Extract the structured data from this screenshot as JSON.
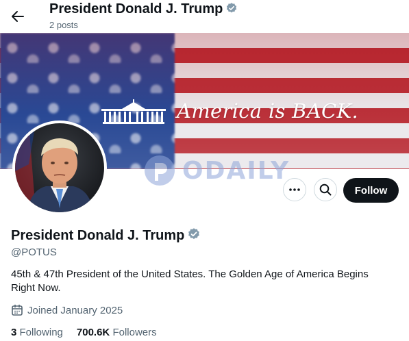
{
  "header": {
    "name": "President Donald J. Trump",
    "posts": "2 posts"
  },
  "banner": {
    "tagline": "America is BACK.",
    "watermark": "ODAILY"
  },
  "profile": {
    "name": "President Donald J. Trump",
    "handle": "@POTUS",
    "bio": "45th & 47th President of the United States. The Golden Age of America Begins Right Now.",
    "joined": "Joined January 2025"
  },
  "stats": {
    "following_count": "3",
    "following_label": "Following",
    "followers_count": "700.6K",
    "followers_label": "Followers"
  },
  "actions": {
    "follow_label": "Follow"
  },
  "colors": {
    "verified": "#829aab",
    "follow_bg": "#0f1419",
    "flag_blue": "#1e3f8f",
    "flag_red": "#b7262f"
  }
}
